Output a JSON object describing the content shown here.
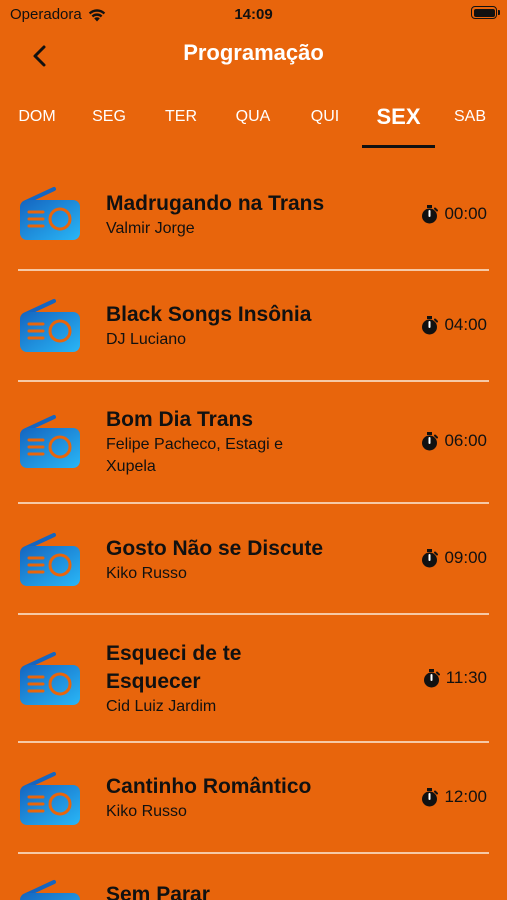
{
  "status_bar": {
    "carrier": "Operadora",
    "time": "14:09"
  },
  "nav": {
    "title": "Programação"
  },
  "tabs": [
    {
      "label": "DOM"
    },
    {
      "label": "SEG"
    },
    {
      "label": "TER"
    },
    {
      "label": "QUA"
    },
    {
      "label": "QUI"
    },
    {
      "label": "SEX",
      "active": true
    },
    {
      "label": "SAB"
    }
  ],
  "programs": [
    {
      "title": "Madrugando na Trans",
      "host": "Valmir Jorge",
      "time": "00:00"
    },
    {
      "title": "Black Songs Insônia",
      "host": "DJ Luciano",
      "time": "04:00"
    },
    {
      "title": "Bom Dia Trans",
      "host": "Felipe Pacheco, Estagi e Xupela",
      "time": "06:00"
    },
    {
      "title": "Gosto Não se Discute",
      "host": "Kiko Russo",
      "time": "09:00"
    },
    {
      "title": "Esqueci de te Esquecer",
      "host": "Cid Luiz Jardim",
      "time": "11:30"
    },
    {
      "title": "Cantinho Romântico",
      "host": "Kiko Russo",
      "time": "12:00"
    },
    {
      "title": "Sem Parar",
      "host": "",
      "time": ""
    }
  ],
  "colors": {
    "background": "#E8650C",
    "icon_gradient_top": "#1565C0",
    "icon_gradient_bottom": "#29B6F6",
    "divider": "#F6C9A6"
  },
  "icons": {
    "back": "chevron-left-icon",
    "program": "radio-icon",
    "time": "stopwatch-icon"
  }
}
